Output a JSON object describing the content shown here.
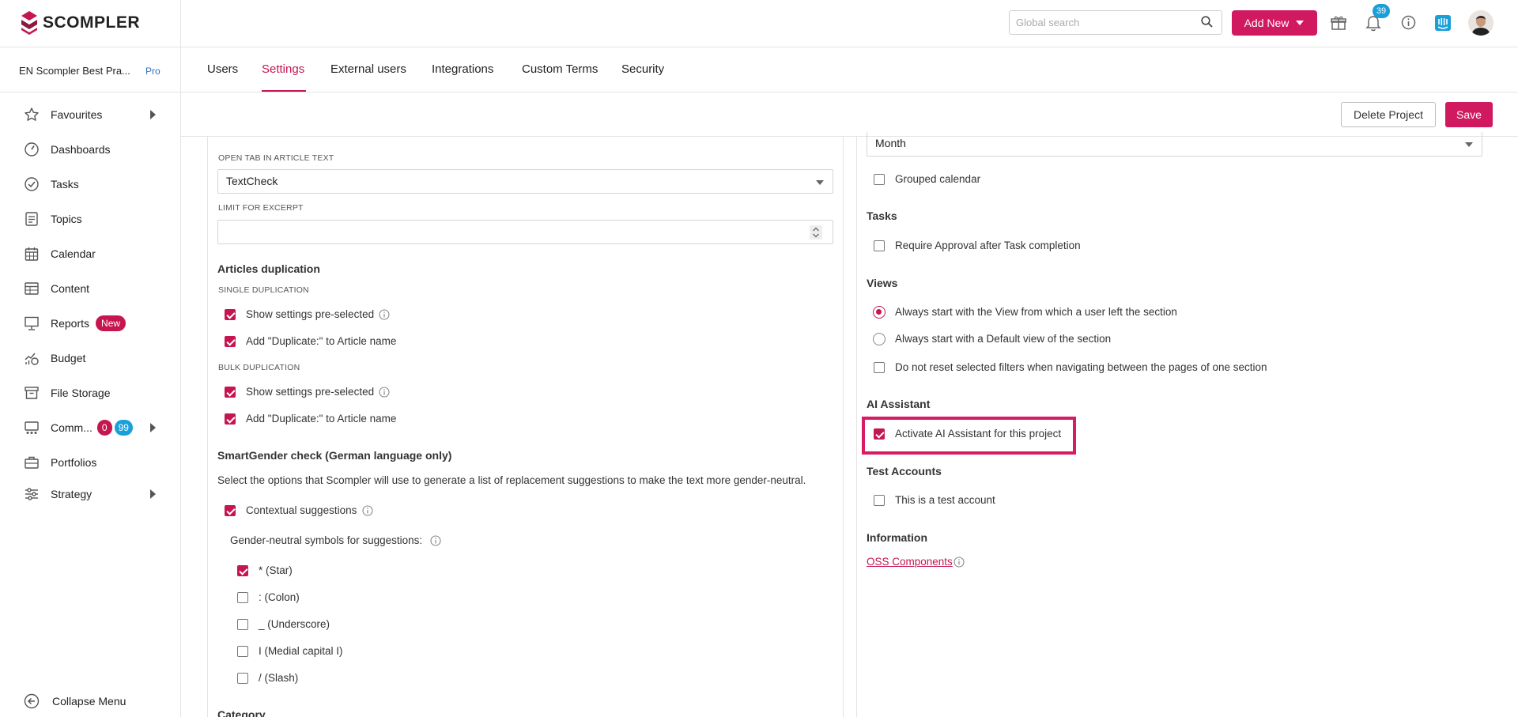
{
  "brand": {
    "name": "SCOMPLER",
    "accent": "#d1195f",
    "link": "#c5164f"
  },
  "header": {
    "search_placeholder": "Global search",
    "add_new_label": "Add New",
    "notification_count": "39",
    "icons": [
      "search-icon",
      "gift-icon",
      "bell-icon",
      "info-icon",
      "intercom-icon"
    ]
  },
  "project": {
    "name": "EN Scompler Best Pra...",
    "plan": "Pro"
  },
  "tabs": [
    {
      "label": "Users",
      "active": false
    },
    {
      "label": "Settings",
      "active": true
    },
    {
      "label": "External users",
      "active": false
    },
    {
      "label": "Integrations",
      "active": false
    },
    {
      "label": "Custom Terms",
      "active": false
    },
    {
      "label": "Security",
      "active": false
    }
  ],
  "actions": {
    "delete_label": "Delete Project",
    "save_label": "Save"
  },
  "sidebar": {
    "items": [
      {
        "label": "Favourites",
        "icon": "star-icon"
      },
      {
        "label": "Dashboards",
        "icon": "dashboard-icon"
      },
      {
        "label": "Tasks",
        "icon": "check-circle-icon"
      },
      {
        "label": "Topics",
        "icon": "topics-icon"
      },
      {
        "label": "Calendar",
        "icon": "calendar-icon"
      },
      {
        "label": "Content",
        "icon": "table-icon"
      },
      {
        "label": "Reports",
        "icon": "presentation-icon",
        "badge": "New"
      },
      {
        "label": "Budget",
        "icon": "budget-icon"
      },
      {
        "label": "File Storage",
        "icon": "archive-icon"
      },
      {
        "label": "Comm...",
        "icon": "community-icon",
        "badges": [
          "0",
          "99"
        ]
      },
      {
        "label": "Portfolios",
        "icon": "briefcase-icon"
      },
      {
        "label": "Strategy",
        "icon": "sliders-icon"
      }
    ],
    "collapse_label": "Collapse Menu"
  },
  "left": {
    "open_tab_label": "OPEN TAB IN ARTICLE TEXT",
    "open_tab_value": "TextCheck",
    "limit_label": "LIMIT FOR EXCERPT",
    "limit_value": "",
    "dup_title": "Articles duplication",
    "single_label": "SINGLE DUPLICATION",
    "single_options": [
      {
        "label": "Show settings pre-selected",
        "checked": true
      },
      {
        "label": "Add \"Duplicate:\" to Article name",
        "checked": true
      }
    ],
    "bulk_label": "BULK DUPLICATION",
    "bulk_options": [
      {
        "label": "Show settings pre-selected",
        "checked": true
      },
      {
        "label": "Add \"Duplicate:\" to Article name",
        "checked": true
      }
    ],
    "smartgender_title": "SmartGender check (German language only)",
    "smartgender_desc": "Select the options that Scompler will use to generate a list of replacement suggestions to make the text more gender-neutral.",
    "contextual_label": "Contextual suggestions",
    "contextual_checked": true,
    "symbols_label": "Gender-neutral symbols for suggestions:",
    "symbols": [
      {
        "label": "* (Star)",
        "checked": true
      },
      {
        "label": ": (Colon)",
        "checked": false
      },
      {
        "label": "_ (Underscore)",
        "checked": false
      },
      {
        "label": "I (Medial capital I)",
        "checked": false
      },
      {
        "label": "/ (Slash)",
        "checked": false
      }
    ],
    "category_title": "Category"
  },
  "right": {
    "period_value": "Month",
    "grouped_label": "Grouped calendar",
    "grouped_checked": false,
    "tasks_title": "Tasks",
    "tasks_option": "Require Approval after Task completion",
    "views_title": "Views",
    "views_options": [
      {
        "label": "Always start with the View from which a user left the section",
        "selected": true
      },
      {
        "label": "Always start with a Default view of the section",
        "selected": false
      }
    ],
    "views_reset_label": "Do not reset selected filters when navigating between the pages of one section",
    "ai_title": "AI Assistant",
    "ai_label": "Activate AI Assistant for this project",
    "ai_checked": true,
    "test_title": "Test Accounts",
    "test_label": "This is a test account",
    "info_title": "Information",
    "oss_label": "OSS Components"
  }
}
